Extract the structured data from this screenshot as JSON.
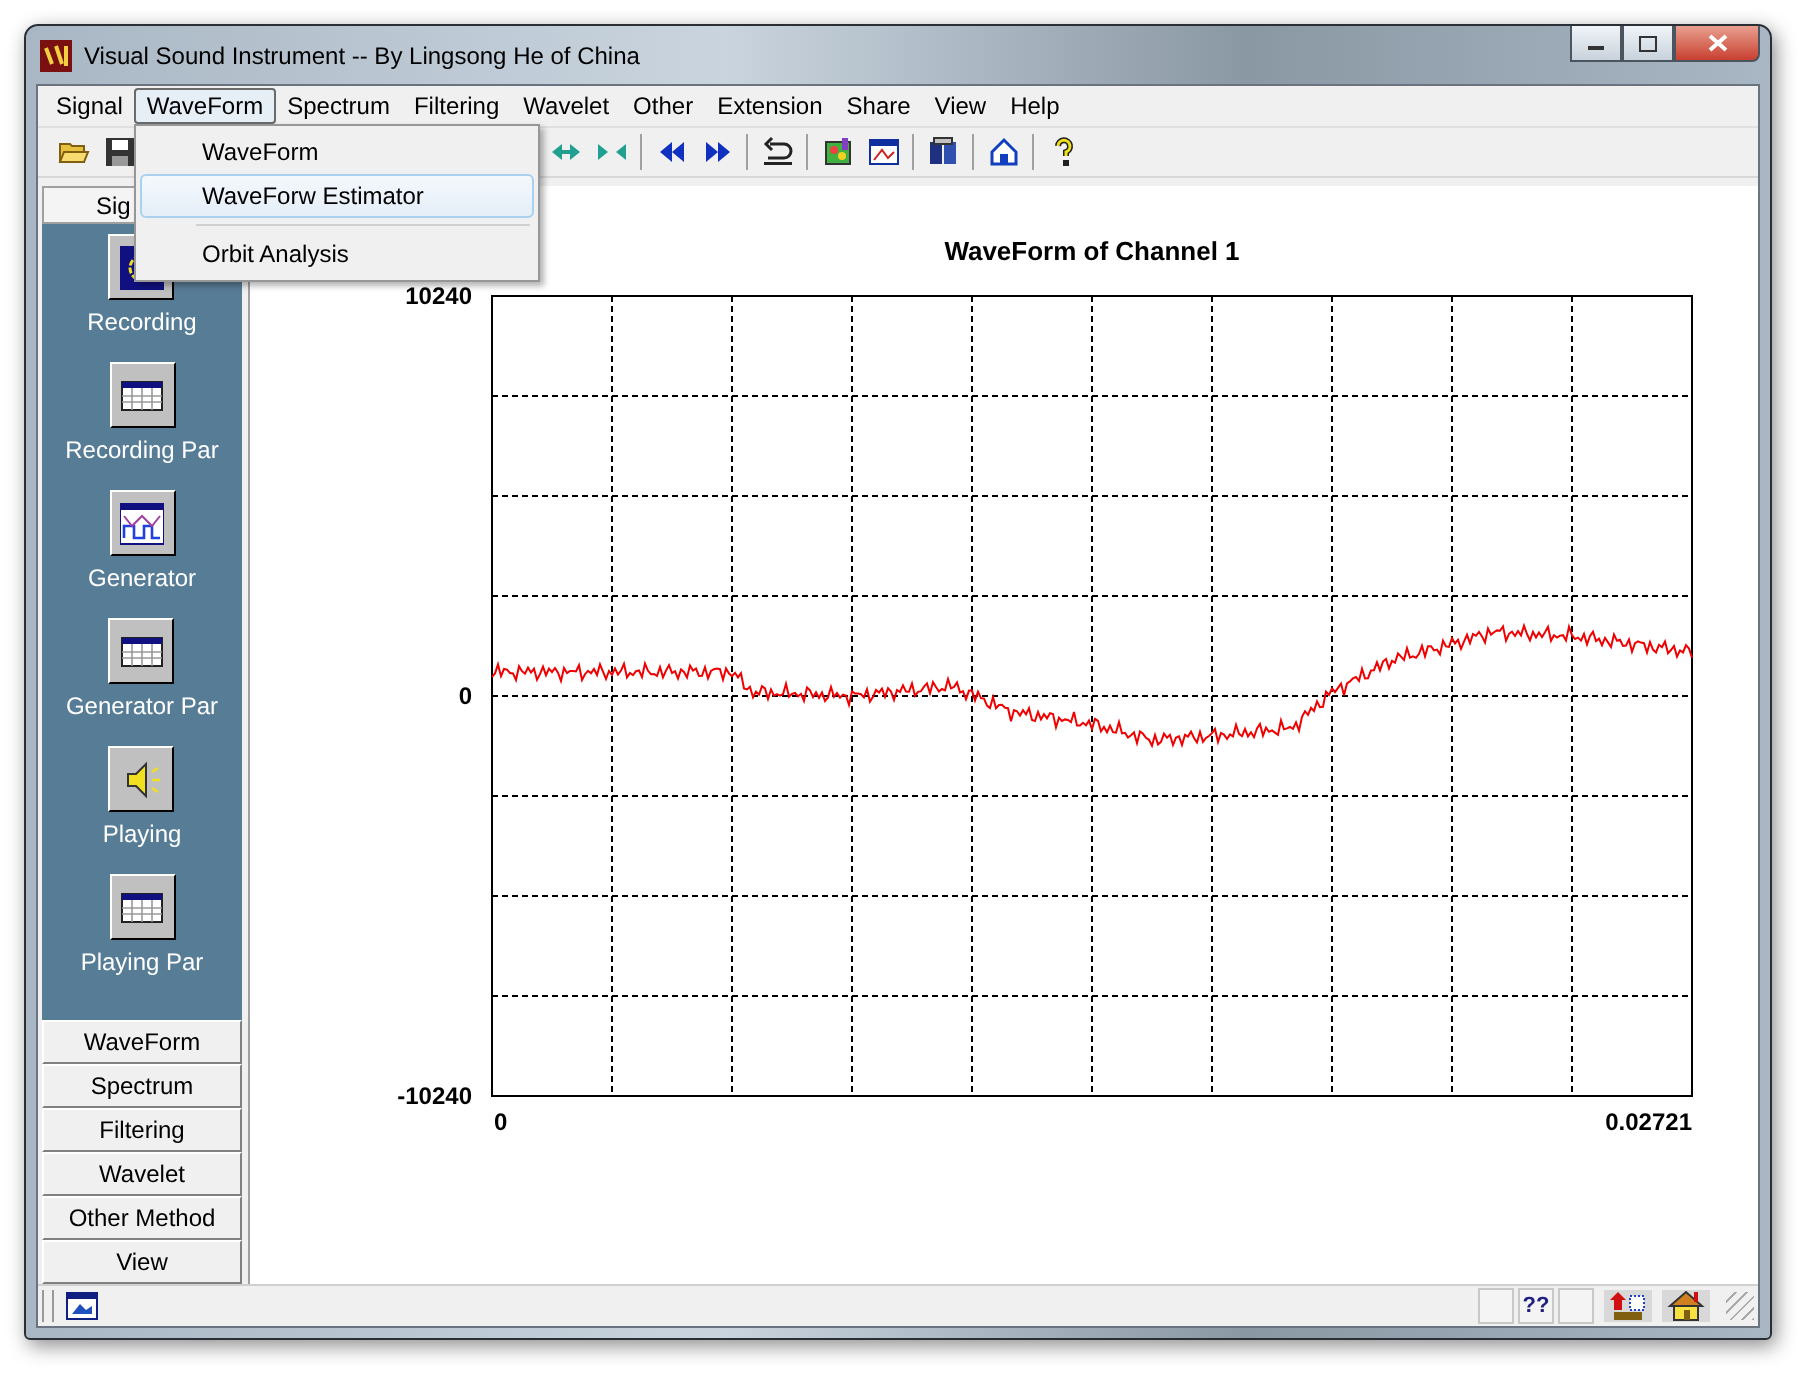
{
  "window": {
    "title": "Visual Sound Instrument -- By Lingsong He of China"
  },
  "menu": [
    {
      "label": "Signal",
      "selected": false
    },
    {
      "label": "WaveForm",
      "selected": true
    },
    {
      "label": "Spectrum",
      "selected": false
    },
    {
      "label": "Filtering",
      "selected": false
    },
    {
      "label": "Wavelet",
      "selected": false
    },
    {
      "label": "Other",
      "selected": false
    },
    {
      "label": "Extension",
      "selected": false
    },
    {
      "label": "Share",
      "selected": false
    },
    {
      "label": "View",
      "selected": false
    },
    {
      "label": "Help",
      "selected": false
    }
  ],
  "dropdown": [
    {
      "kind": "item",
      "label": "WaveForm",
      "highlighted": false
    },
    {
      "kind": "item",
      "label": "WaveForw Estimator",
      "highlighted": true
    },
    {
      "kind": "separator"
    },
    {
      "kind": "item",
      "label": "Orbit Analysis",
      "highlighted": false
    }
  ],
  "sidebar": {
    "header": "Sig",
    "tools": [
      {
        "kind": "record",
        "label": "Recording"
      },
      {
        "kind": "table",
        "label": "Recording Par"
      },
      {
        "kind": "generator",
        "label": "Generator"
      },
      {
        "kind": "table",
        "label": "Generator Par"
      },
      {
        "kind": "speaker",
        "label": "Playing"
      },
      {
        "kind": "table",
        "label": "Playing Par"
      }
    ],
    "sections": [
      "WaveForm",
      "Spectrum",
      "Filtering",
      "Wavelet",
      "Other Method",
      "View"
    ]
  },
  "chart": {
    "title": "WaveForm of Channel 1",
    "y_labels": [
      "10240",
      "0",
      "-10240"
    ],
    "x_labels": [
      "0",
      "0.02721"
    ]
  },
  "status_bar": {
    "help": "??"
  }
}
